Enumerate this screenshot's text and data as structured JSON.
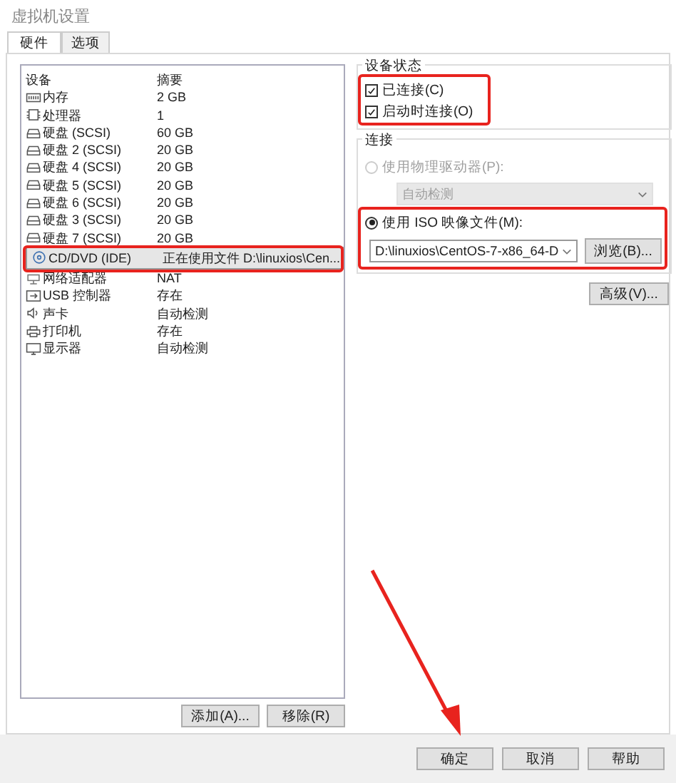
{
  "window": {
    "title": "虚拟机设置"
  },
  "tabs": [
    {
      "label": "硬件",
      "selected": true
    },
    {
      "label": "选项",
      "selected": false
    }
  ],
  "devices": {
    "columns": [
      "设备",
      "摘要"
    ],
    "rows": [
      {
        "kind": "memory",
        "name": "内存",
        "summary": "2 GB",
        "selected": false,
        "highlighted": false
      },
      {
        "kind": "cpu",
        "name": "处理器",
        "summary": "1",
        "selected": false,
        "highlighted": false
      },
      {
        "kind": "disk",
        "name": "硬盘 (SCSI)",
        "summary": "60 GB",
        "selected": false,
        "highlighted": false
      },
      {
        "kind": "disk",
        "name": "硬盘 2 (SCSI)",
        "summary": "20 GB",
        "selected": false,
        "highlighted": false
      },
      {
        "kind": "disk",
        "name": "硬盘 4 (SCSI)",
        "summary": "20 GB",
        "selected": false,
        "highlighted": false
      },
      {
        "kind": "disk",
        "name": "硬盘 5 (SCSI)",
        "summary": "20 GB",
        "selected": false,
        "highlighted": false
      },
      {
        "kind": "disk",
        "name": "硬盘 6 (SCSI)",
        "summary": "20 GB",
        "selected": false,
        "highlighted": false
      },
      {
        "kind": "disk",
        "name": "硬盘 3 (SCSI)",
        "summary": "20 GB",
        "selected": false,
        "highlighted": false
      },
      {
        "kind": "disk",
        "name": "硬盘 7 (SCSI)",
        "summary": "20 GB",
        "selected": false,
        "highlighted": false
      },
      {
        "kind": "cd",
        "name": "CD/DVD (IDE)",
        "summary": "正在使用文件 D:\\linuxios\\Cen...",
        "selected": true,
        "highlighted": true
      },
      {
        "kind": "network",
        "name": "网络适配器",
        "summary": "NAT",
        "selected": false,
        "highlighted": false
      },
      {
        "kind": "usb",
        "name": "USB 控制器",
        "summary": "存在",
        "selected": false,
        "highlighted": false
      },
      {
        "kind": "sound",
        "name": "声卡",
        "summary": "自动检测",
        "selected": false,
        "highlighted": false
      },
      {
        "kind": "printer",
        "name": "打印机",
        "summary": "存在",
        "selected": false,
        "highlighted": false
      },
      {
        "kind": "display",
        "name": "显示器",
        "summary": "自动检测",
        "selected": false,
        "highlighted": false
      }
    ],
    "buttons": [
      "添加(A)...",
      "移除(R)"
    ]
  },
  "device_status": {
    "title": "设备状态",
    "highlighted": true,
    "checkboxes": [
      {
        "label": "已连接(C)",
        "checked": true
      },
      {
        "label": "启动时连接(O)",
        "checked": true
      }
    ]
  },
  "connection": {
    "title": "连接",
    "options": [
      {
        "label": "使用物理驱动器(P):",
        "selected": false,
        "disabled": true,
        "highlighted": false,
        "value": "自动检测"
      },
      {
        "label": "使用 ISO 映像文件(M):",
        "selected": true,
        "disabled": false,
        "highlighted": true,
        "value": "D:\\linuxios\\CentOS-7-x86_64-D",
        "browse": "浏览(B)..."
      }
    ]
  },
  "advanced_button": "高级(V)...",
  "footer_buttons": [
    {
      "label": "确定",
      "pointed": true
    },
    {
      "label": "取消",
      "pointed": false
    },
    {
      "label": "帮助",
      "pointed": false
    }
  ]
}
